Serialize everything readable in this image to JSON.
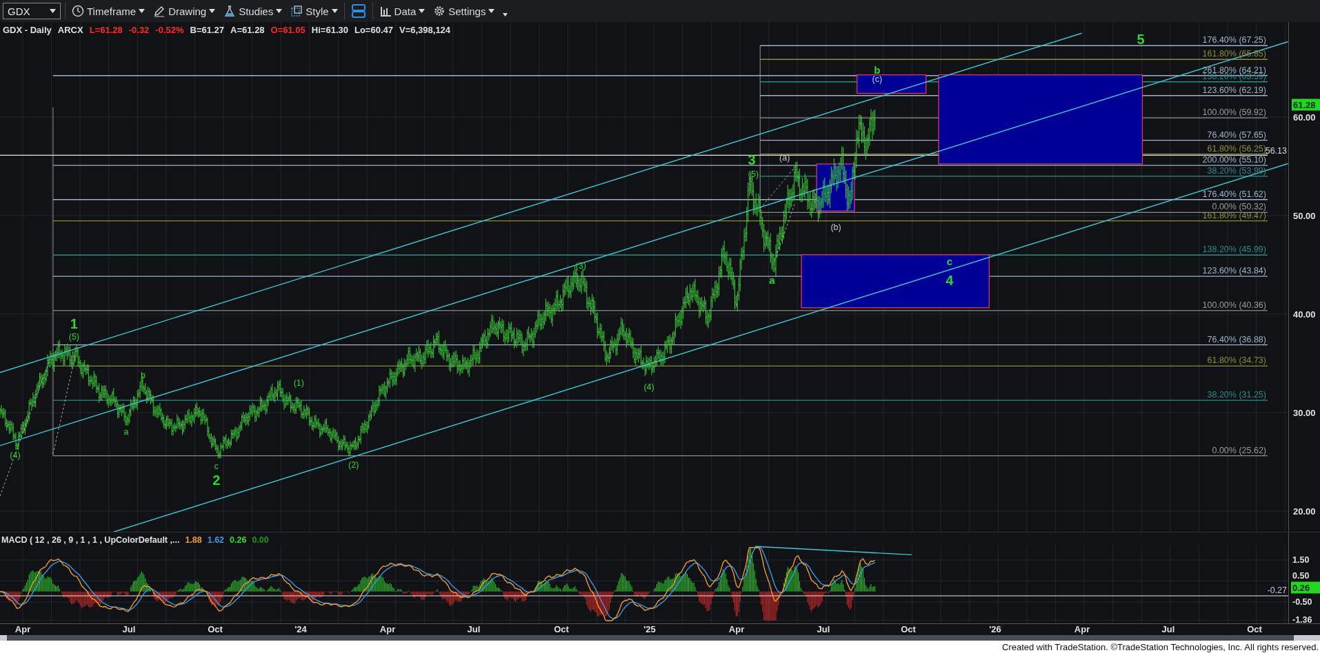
{
  "toolbar": {
    "symbol": "GDX",
    "menus": [
      {
        "label": "Timeframe"
      },
      {
        "label": "Drawing"
      },
      {
        "label": "Studies"
      },
      {
        "label": "Style"
      },
      {
        "label": "Data"
      },
      {
        "label": "Settings"
      }
    ]
  },
  "quote": [
    {
      "text": "GDX - Daily",
      "color": "#e0e0e0"
    },
    {
      "text": "ARCX",
      "color": "#e0e0e0"
    },
    {
      "text": "L=61.28",
      "color": "#ff2a2a"
    },
    {
      "text": "-0.32",
      "color": "#ff2a2a"
    },
    {
      "text": "-0.52%",
      "color": "#ff2a2a"
    },
    {
      "text": "B=61.27",
      "color": "#e0e0e0"
    },
    {
      "text": "A=61.28",
      "color": "#e0e0e0"
    },
    {
      "text": "O=61.05",
      "color": "#ff2a2a"
    },
    {
      "text": "Hi=61.30",
      "color": "#e0e0e0"
    },
    {
      "text": "Lo=60.47",
      "color": "#e0e0e0"
    },
    {
      "text": "V=6,398,124",
      "color": "#e0e0e0"
    }
  ],
  "main_chart": {
    "fib_levels": [
      {
        "label": "176.40% (67.25)",
        "color": "#9fb2c8",
        "kind": "short"
      },
      {
        "label": "161.80% (65.85)",
        "color": "#8c8c3c",
        "kind": "short"
      },
      {
        "label": "261.80% (64.21)",
        "color": "#9fb2c8",
        "kind": "long"
      },
      {
        "label": "138.20% (63.59)",
        "color": "#2c8c8c",
        "kind": "short"
      },
      {
        "label": "123.60% (62.19)",
        "color": "#9fb2c8",
        "kind": "short"
      },
      {
        "label": "100.00% (59.92)",
        "color": "#8c8c8c",
        "kind": "short"
      },
      {
        "label": "76.40% (57.65)",
        "color": "#9fb2c8",
        "kind": "short"
      },
      {
        "label": "61.80% (56.25)",
        "color": "#8c8c3c",
        "kind": "short"
      },
      {
        "label": "200.00% (55.10)",
        "color": "#9fb2c8",
        "kind": "long"
      },
      {
        "label": "38.20% (53.99)",
        "color": "#2c8c8c",
        "kind": "short"
      },
      {
        "label": "176.40% (51.62)",
        "color": "#9fb2c8",
        "kind": "long"
      },
      {
        "label": "0.00% (50.32)",
        "color": "#8c8c8c",
        "kind": "short"
      },
      {
        "label": "161.80% (49.47)",
        "color": "#8c8c3c",
        "kind": "long"
      },
      {
        "label": "138.20% (45.99)",
        "color": "#2c8c8c",
        "kind": "long"
      },
      {
        "label": "123.60% (43.84)",
        "color": "#9fb2c8",
        "kind": "long"
      },
      {
        "label": "100.00% (40.36)",
        "color": "#8c8c8c",
        "kind": "long"
      },
      {
        "label": "76.40% (36.88)",
        "color": "#9fb2c8",
        "kind": "long"
      },
      {
        "label": "61.80% (34.73)",
        "color": "#8c8c3c",
        "kind": "long"
      },
      {
        "label": "38.20% (31.25)",
        "color": "#2c8c8c",
        "kind": "long"
      },
      {
        "label": "0.00% (25.62)",
        "color": "#8c8c8c",
        "kind": "long"
      }
    ],
    "reference_line": {
      "label": "56.13"
    },
    "wave_labels": [
      {
        "text": "(4)",
        "kind": "minor",
        "color": "#2ed62e"
      },
      {
        "text": "1",
        "kind": "major",
        "color": "#2ed62e"
      },
      {
        "text": "(5)",
        "kind": "minor",
        "color": "#2ed62e"
      },
      {
        "text": "a",
        "kind": "minor",
        "color": "#2ed62e"
      },
      {
        "text": "b",
        "kind": "minor",
        "color": "#2ed62e"
      },
      {
        "text": "c",
        "kind": "minor",
        "color": "#2ed62e"
      },
      {
        "text": "2",
        "kind": "major",
        "color": "#2ed62e"
      },
      {
        "text": "(1)",
        "kind": "minor",
        "color": "#2ed62e"
      },
      {
        "text": "(2)",
        "kind": "minor",
        "color": "#2ed62e"
      },
      {
        "text": "(3)",
        "kind": "minor",
        "color": "#2ed62e"
      },
      {
        "text": "(4)",
        "kind": "minor",
        "color": "#2ed62e"
      },
      {
        "text": "3",
        "kind": "major",
        "color": "#2ed62e"
      },
      {
        "text": "(5)",
        "kind": "minor",
        "color": "#2ed62e"
      },
      {
        "text": "a",
        "kind": "medium",
        "color": "#2ed62e"
      },
      {
        "text": "(a)",
        "kind": "minor",
        "color": "#c8c8c8"
      },
      {
        "text": "(b)",
        "kind": "minor",
        "color": "#c8c8c8"
      },
      {
        "text": "b",
        "kind": "medium",
        "color": "#2ed62e"
      },
      {
        "text": "(c)",
        "kind": "minor",
        "color": "#c8c8c8"
      },
      {
        "text": "c",
        "kind": "medium",
        "color": "#2ed62e"
      },
      {
        "text": "4",
        "kind": "major",
        "color": "#2ed62e"
      },
      {
        "text": "5",
        "kind": "major",
        "color": "#2ed62e"
      }
    ],
    "price_axis": [
      "60.00",
      "50.00",
      "40.00",
      "30.00",
      "20.00"
    ],
    "last_price": "61.28"
  },
  "macd": {
    "title": "MACD ( 12 , 26 , 9 , 1 , 1 , UpColorDefault ,...",
    "values": [
      {
        "text": "1.88",
        "color": "#f39a2e"
      },
      {
        "text": "1.62",
        "color": "#3a9ae8"
      },
      {
        "text": "0.26",
        "color": "#2edc2e"
      },
      {
        "text": "0.00",
        "color": "#1a9a1a"
      }
    ],
    "axis": [
      "1.50",
      "0.50",
      "-0.50",
      "-1.36"
    ],
    "zero_label": "-0.27",
    "last_value": "0.26"
  },
  "time_axis": [
    "Apr",
    "Jul",
    "Oct",
    "'24",
    "Apr",
    "Jul",
    "Oct",
    "'25",
    "Apr",
    "Jul",
    "Oct",
    "'26",
    "Apr",
    "Jul",
    "Oct"
  ],
  "footer": "Created with TradeStation. ©TradeStation Technologies, Inc. All rights reserved."
}
